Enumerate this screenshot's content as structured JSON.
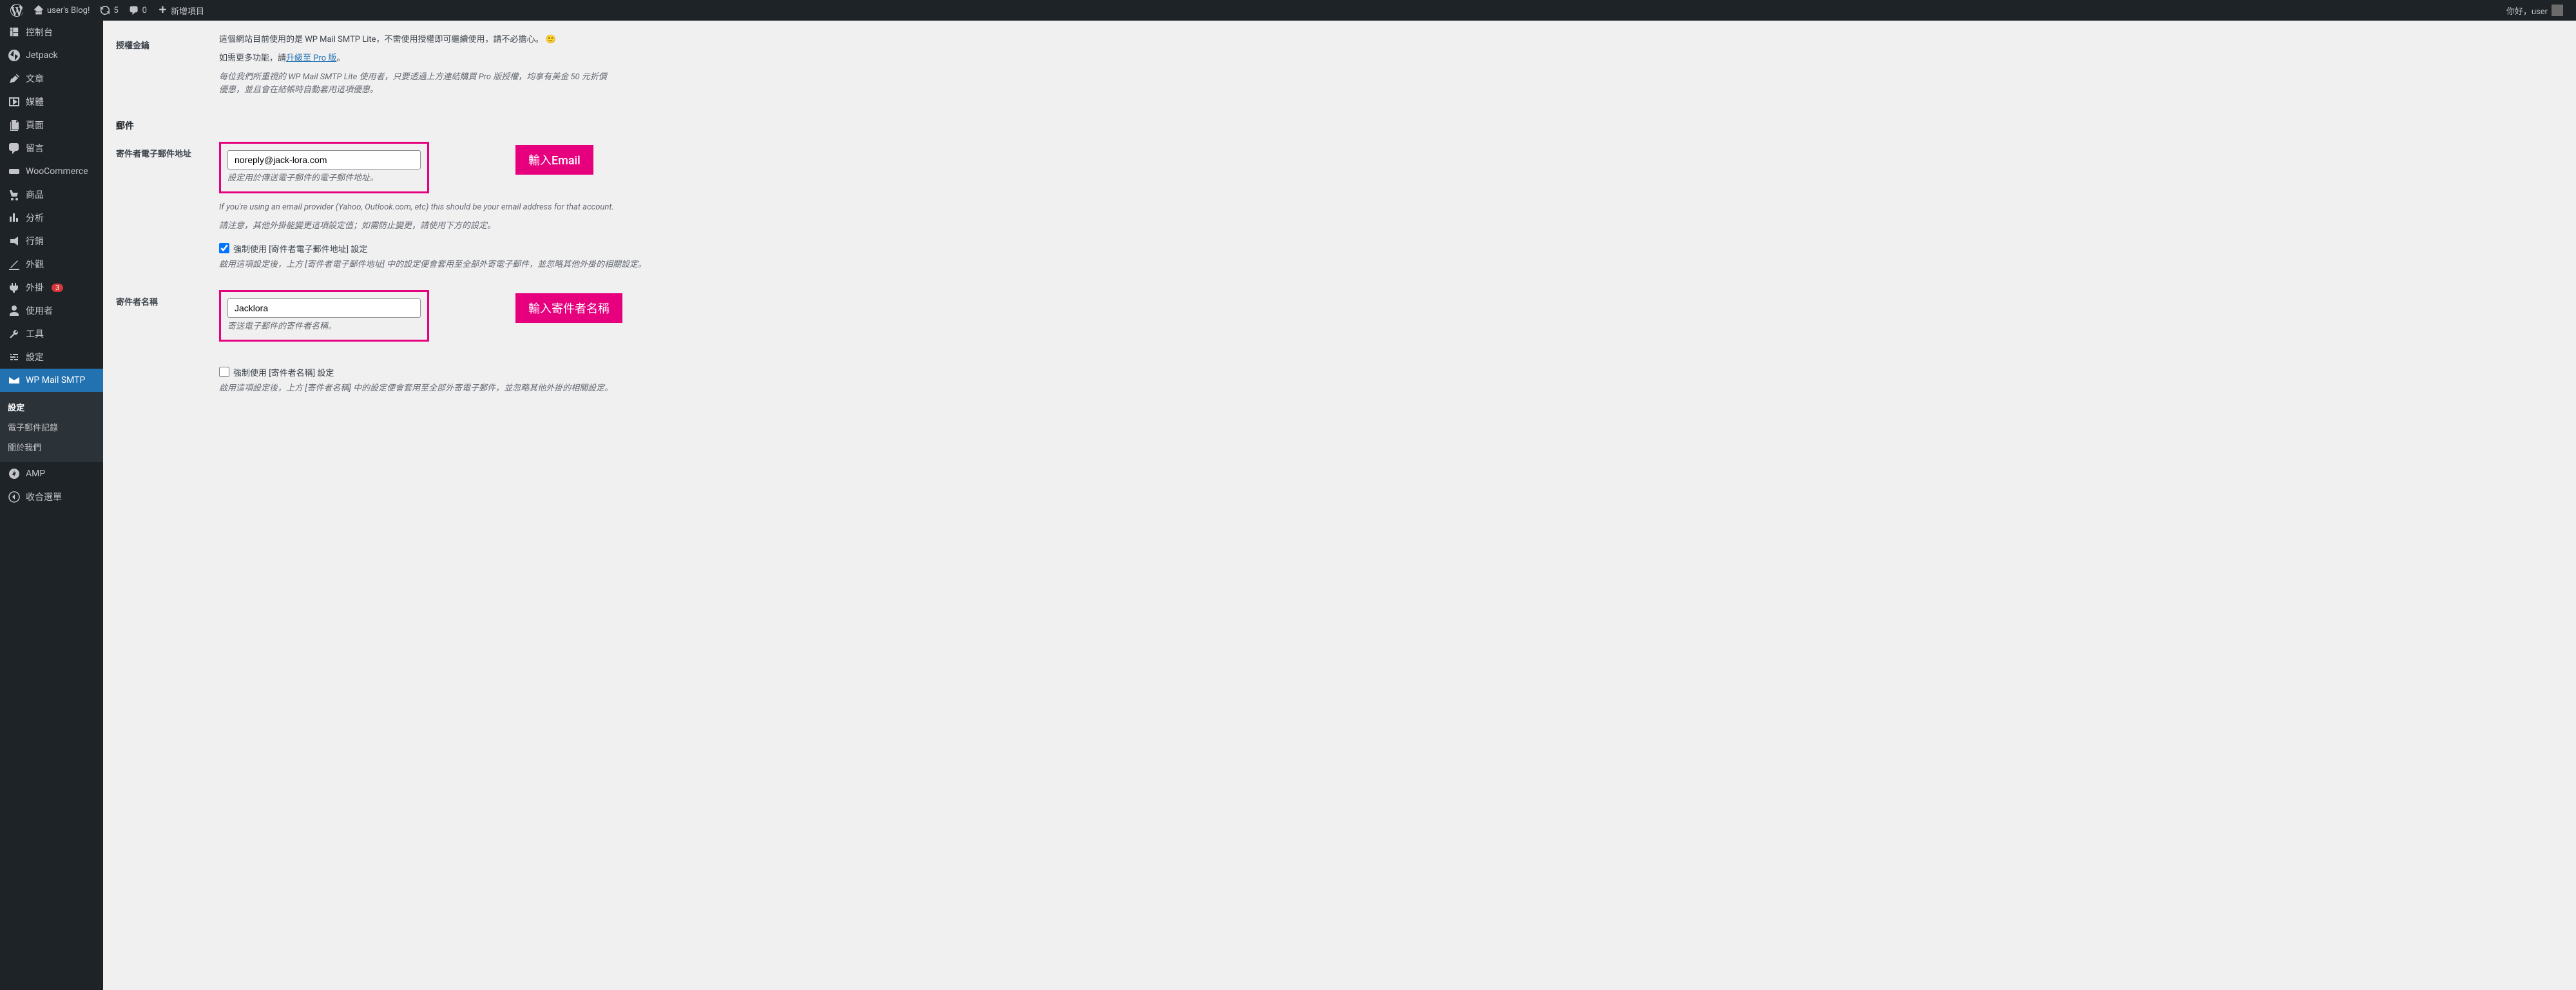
{
  "adminbar": {
    "site_name": "user's Blog!",
    "updates": "5",
    "comments": "0",
    "new_item": "新增項目",
    "greeting": "你好，user"
  },
  "sidebar": {
    "items": [
      {
        "label": "控制台",
        "icon": "dashboard"
      },
      {
        "label": "Jetpack",
        "icon": "jetpack"
      },
      {
        "label": "文章",
        "icon": "posts"
      },
      {
        "label": "媒體",
        "icon": "media"
      },
      {
        "label": "頁面",
        "icon": "pages"
      },
      {
        "label": "留言",
        "icon": "comments"
      },
      {
        "label": "WooCommerce",
        "icon": "woo"
      },
      {
        "label": "商品",
        "icon": "products"
      },
      {
        "label": "分析",
        "icon": "analytics"
      },
      {
        "label": "行銷",
        "icon": "marketing"
      },
      {
        "label": "外觀",
        "icon": "appearance"
      },
      {
        "label": "外掛",
        "icon": "plugins",
        "badge": "3"
      },
      {
        "label": "使用者",
        "icon": "users"
      },
      {
        "label": "工具",
        "icon": "tools"
      },
      {
        "label": "設定",
        "icon": "settings"
      },
      {
        "label": "WP Mail SMTP",
        "icon": "mail",
        "active": true
      },
      {
        "label": "AMP",
        "icon": "amp"
      },
      {
        "label": "收合選單",
        "icon": "collapse"
      }
    ],
    "sub": [
      {
        "label": "設定",
        "bold": true
      },
      {
        "label": "電子郵件記錄"
      },
      {
        "label": "關於我們"
      }
    ]
  },
  "license": {
    "title": "授權金鑰",
    "desc_prefix": "這個網站目前使用的是 WP Mail SMTP Lite，不需使用授權即可繼續使用，請不必擔心。",
    "upgrade_prefix": "如需更多功能，請",
    "upgrade_link": "升級至 Pro 版",
    "upgrade_suffix": "。",
    "note1": "每位我們所重視的 WP Mail SMTP Lite 使用者，只要透過上方連結購買 Pro 版授權，均享有美金 50 元折價優惠，並且會在結帳時自動套用這項優惠。"
  },
  "mail": {
    "title": "郵件",
    "from_email": {
      "label": "寄件者電子郵件地址",
      "value": "noreply@jack-lora.com",
      "help1": "設定用於傳送電子郵件的電子郵件地址。",
      "help2": "If you're using an email provider (Yahoo, Outlook.com, etc) this should be your email address for that account.",
      "help3": "請注意，其他外掛能變更這項設定值；如需防止變更，請使用下方的設定。",
      "force_label": "強制使用 [寄件者電子郵件地址] 設定",
      "force_help": "啟用這項設定後，上方 [寄件者電子郵件地址] 中的設定便會套用至全部外寄電子郵件，並忽略其他外掛的相關設定。",
      "annotation": "輸入Email"
    },
    "from_name": {
      "label": "寄件者名稱",
      "value": "Jacklora",
      "help1": "寄送電子郵件的寄件者名稱。",
      "force_label": "強制使用 [寄件者名稱] 設定",
      "force_help": "啟用這項設定後，上方 [寄件者名稱] 中的設定便會套用至全部外寄電子郵件，並忽略其他外掛的相關設定。",
      "annotation": "輸入寄件者名稱"
    }
  }
}
